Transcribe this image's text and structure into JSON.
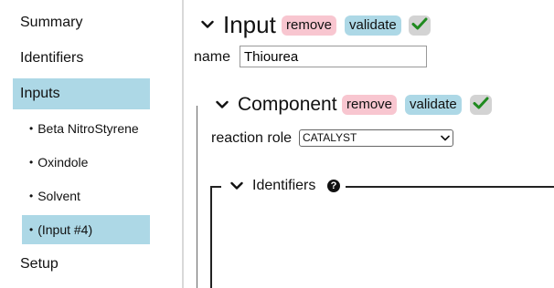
{
  "sidebar": {
    "items": [
      {
        "label": "Summary"
      },
      {
        "label": "Identifiers"
      },
      {
        "label": "Inputs"
      },
      {
        "label": "Setup"
      }
    ],
    "sub_items": [
      {
        "label": "Beta NitroStyrene"
      },
      {
        "label": "Oxindole"
      },
      {
        "label": "Solvent"
      },
      {
        "label": "(Input #4)"
      }
    ],
    "bullet": "•"
  },
  "input_section": {
    "title": "Input",
    "remove_label": "remove",
    "validate_label": "validate",
    "name_label": "name",
    "name_value": "Thiourea"
  },
  "component_section": {
    "title": "Component",
    "remove_label": "remove",
    "validate_label": "validate",
    "reaction_role_label": "reaction role",
    "reaction_role_value": "CATALYST"
  },
  "identifiers_section": {
    "title": "Identifiers",
    "help_glyph": "?"
  },
  "colors": {
    "active_nav": "#add8e6",
    "remove_pill": "#f8c6d0",
    "validate_pill": "#add8e6",
    "check_green": "#1f8a1f"
  },
  "icons": {
    "collapse": "chevron-down-icon",
    "valid": "checkmark-icon",
    "help": "help-icon"
  }
}
